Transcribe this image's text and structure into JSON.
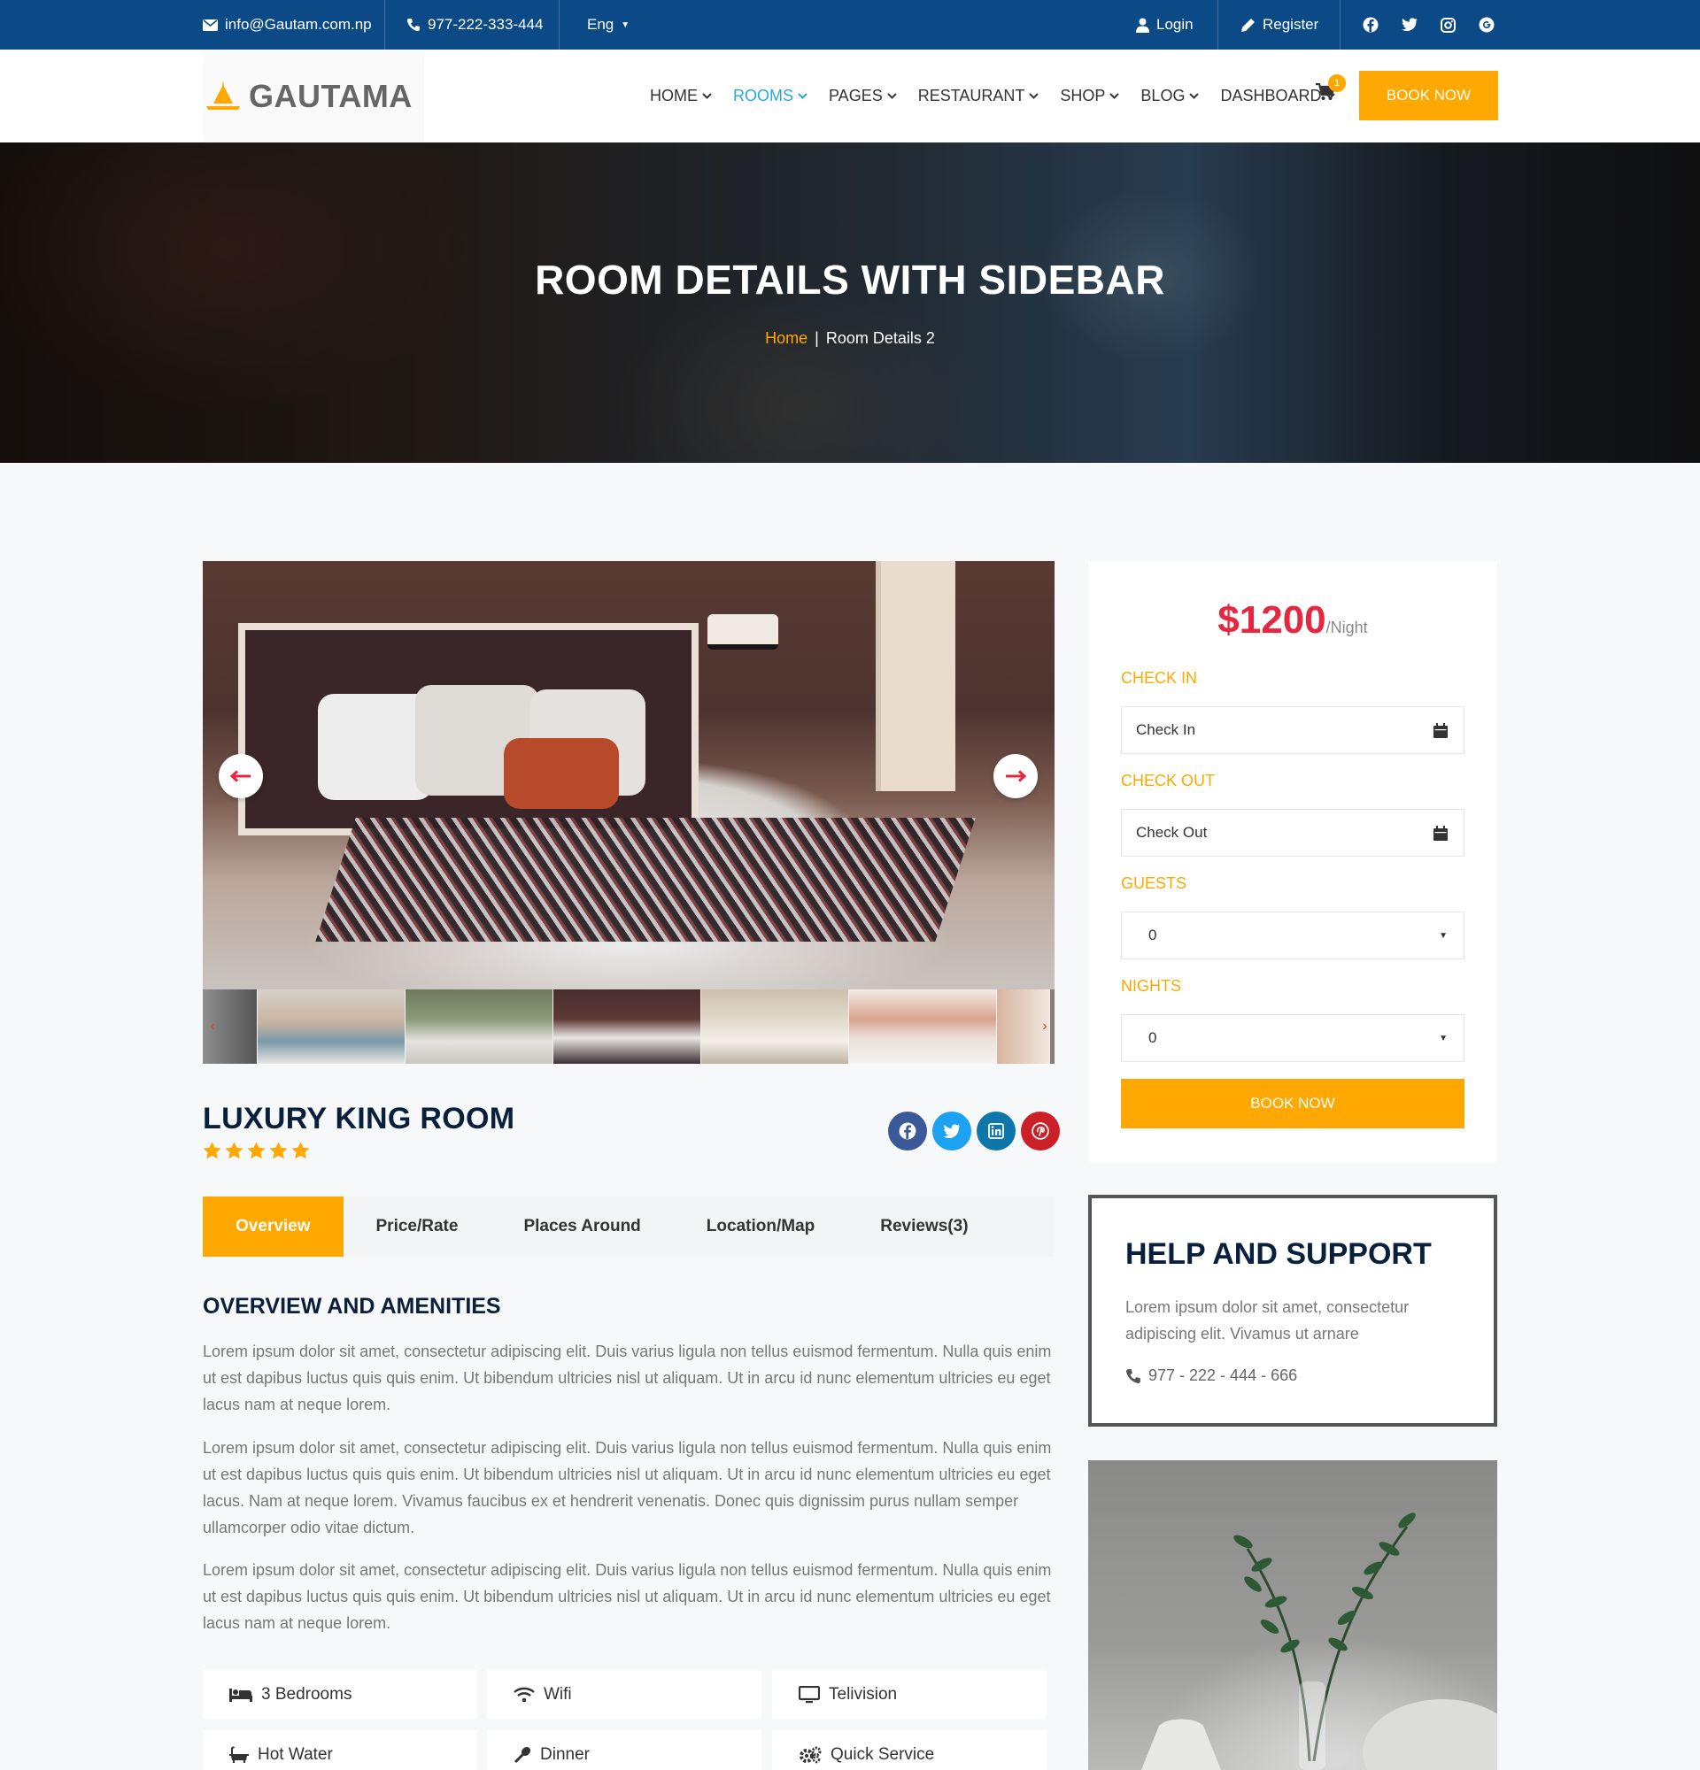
{
  "topbar": {
    "email": "info@Gautam.com.np",
    "phone": "977-222-333-444",
    "language": "Eng",
    "login": "Login",
    "register": "Register",
    "social_icons": [
      "facebook-icon",
      "twitter-icon",
      "instagram-icon",
      "google-plus-icon"
    ]
  },
  "header": {
    "logo_text": "GAUTAMA",
    "nav": [
      "HOME",
      "ROOMS",
      "PAGES",
      "RESTAURANT",
      "SHOP",
      "BLOG",
      "DASHBOARD"
    ],
    "active_nav": "ROOMS",
    "cart_count": "1",
    "book_now": "BOOK NOW"
  },
  "hero": {
    "title": "ROOM DETAILS WITH SIDEBAR",
    "breadcrumb_home": "Home",
    "breadcrumb_sep": "|",
    "breadcrumb_current": "Room Details 2"
  },
  "room": {
    "title": "LUXURY KING ROOM",
    "rating": 5,
    "share_icons": [
      "facebook-icon",
      "twitter-icon",
      "linkedin-icon",
      "pinterest-icon"
    ]
  },
  "tabs": [
    "Overview",
    "Price/Rate",
    "Places Around",
    "Location/Map",
    "Reviews(3)"
  ],
  "active_tab": "Overview",
  "overview": {
    "title": "OVERVIEW AND AMENITIES",
    "paragraphs": [
      "Lorem ipsum dolor sit amet, consectetur adipiscing elit. Duis varius ligula non tellus euismod fermentum. Nulla quis enim ut est dapibus luctus quis quis enim. Ut bibendum ultricies nisl ut aliquam. Ut in arcu id nunc elementum ultricies eu eget lacus nam at neque lorem.",
      "Lorem ipsum dolor sit amet, consectetur adipiscing elit. Duis varius ligula non tellus euismod fermentum. Nulla quis enim ut est dapibus luctus quis quis enim. Ut bibendum ultricies nisl ut aliquam. Ut in arcu id nunc elementum ultricies eu eget lacus. Nam at neque lorem. Vivamus faucibus ex et hendrerit venenatis. Donec quis dignissim purus nullam semper ullamcorper odio vitae dictum.",
      "Lorem ipsum dolor sit amet, consectetur adipiscing elit. Duis varius ligula non tellus euismod fermentum. Nulla quis enim ut est dapibus luctus quis quis enim. Ut bibendum ultricies nisl ut aliquam. Ut in arcu id nunc elementum ultricies eu eget lacus nam at neque lorem."
    ],
    "amenities": [
      "3 Bedrooms",
      "Wifi",
      "Telivision",
      "Hot Water",
      "Dinner",
      "Quick Service"
    ]
  },
  "booking": {
    "price": "$1200",
    "unit": "/Night",
    "check_in_label": "CHECK IN",
    "check_in_placeholder": "Check In",
    "check_out_label": "CHECK OUT",
    "check_out_placeholder": "Check Out",
    "guests_label": "GUESTS",
    "guests_value": "0",
    "nights_label": "NIGHTS",
    "nights_value": "0",
    "button": "BOOK NOW"
  },
  "help": {
    "title": "HELP AND SUPPORT",
    "text": "Lorem ipsum dolor sit amet, consectetur adipiscing elit. Vivamus ut arnare",
    "phone": "977 - 222 - 444 - 666"
  },
  "colors": {
    "topbar": "#0b4a86",
    "accent": "#ffa801",
    "price": "#e5273f",
    "heading": "#0a1f3c",
    "active_nav": "#2aa7e0"
  }
}
